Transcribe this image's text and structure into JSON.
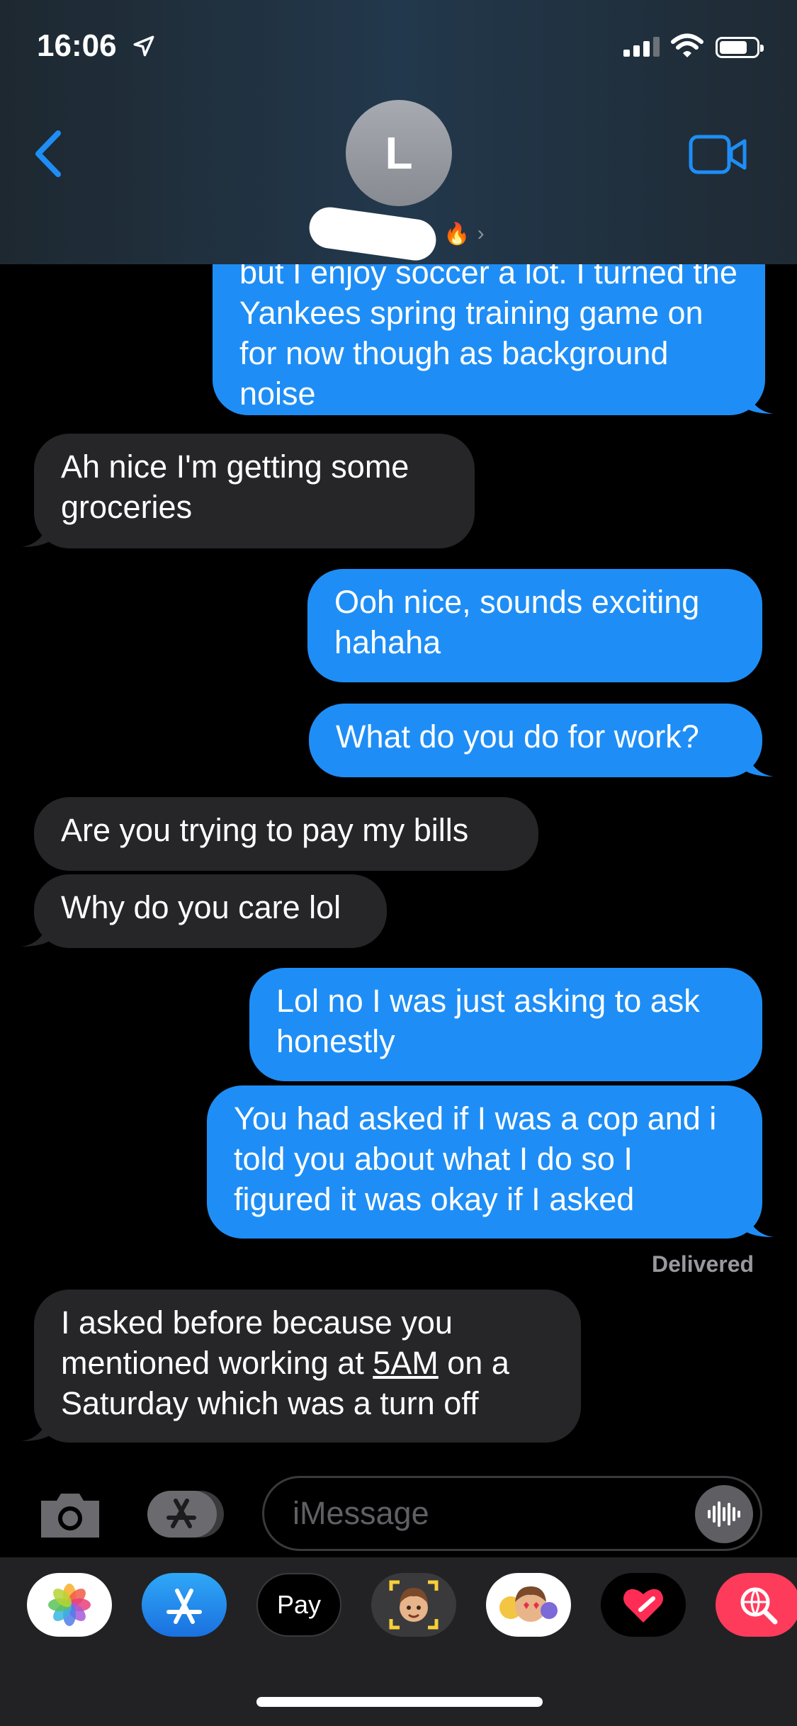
{
  "status_bar": {
    "time": "16:06"
  },
  "contact": {
    "initial": "L"
  },
  "messages": [
    {
      "type": "sent",
      "text": "but I enjoy soccer a lot. I turned the Yankees spring training game on for now though as background noise"
    },
    {
      "type": "received",
      "text": "Ah nice I'm getting some groceries"
    },
    {
      "type": "sent",
      "text": "Ooh nice, sounds exciting hahaha"
    },
    {
      "type": "sent",
      "text": "What do you do for work?"
    },
    {
      "type": "received",
      "text": "Are you trying to pay my bills"
    },
    {
      "type": "received",
      "text": "Why do you care lol"
    },
    {
      "type": "sent",
      "text": "Lol no I was just asking to ask honestly"
    },
    {
      "type": "sent",
      "text": "You had asked if I was a cop and i told you about what I do so I figured it was okay if I asked"
    },
    {
      "type": "received",
      "text_before": "I asked before because you mentioned working at ",
      "text_link": "5AM",
      "text_after": " on a Saturday which was a turn off"
    }
  ],
  "delivered_label": "Delivered",
  "input": {
    "placeholder": "iMessage"
  },
  "app_drawer": [
    {
      "name": "photos-app-icon"
    },
    {
      "name": "app-store-icon"
    },
    {
      "name": "apple-pay-icon",
      "label": "Pay"
    },
    {
      "name": "memoji-icon"
    },
    {
      "name": "memoji-stickers-icon"
    },
    {
      "name": "digital-touch-icon"
    },
    {
      "name": "web-search-icon"
    }
  ],
  "colors": {
    "sent_bubble": "#1e8ef6",
    "received_bubble": "#262629",
    "accent": "#1e8ef6"
  }
}
